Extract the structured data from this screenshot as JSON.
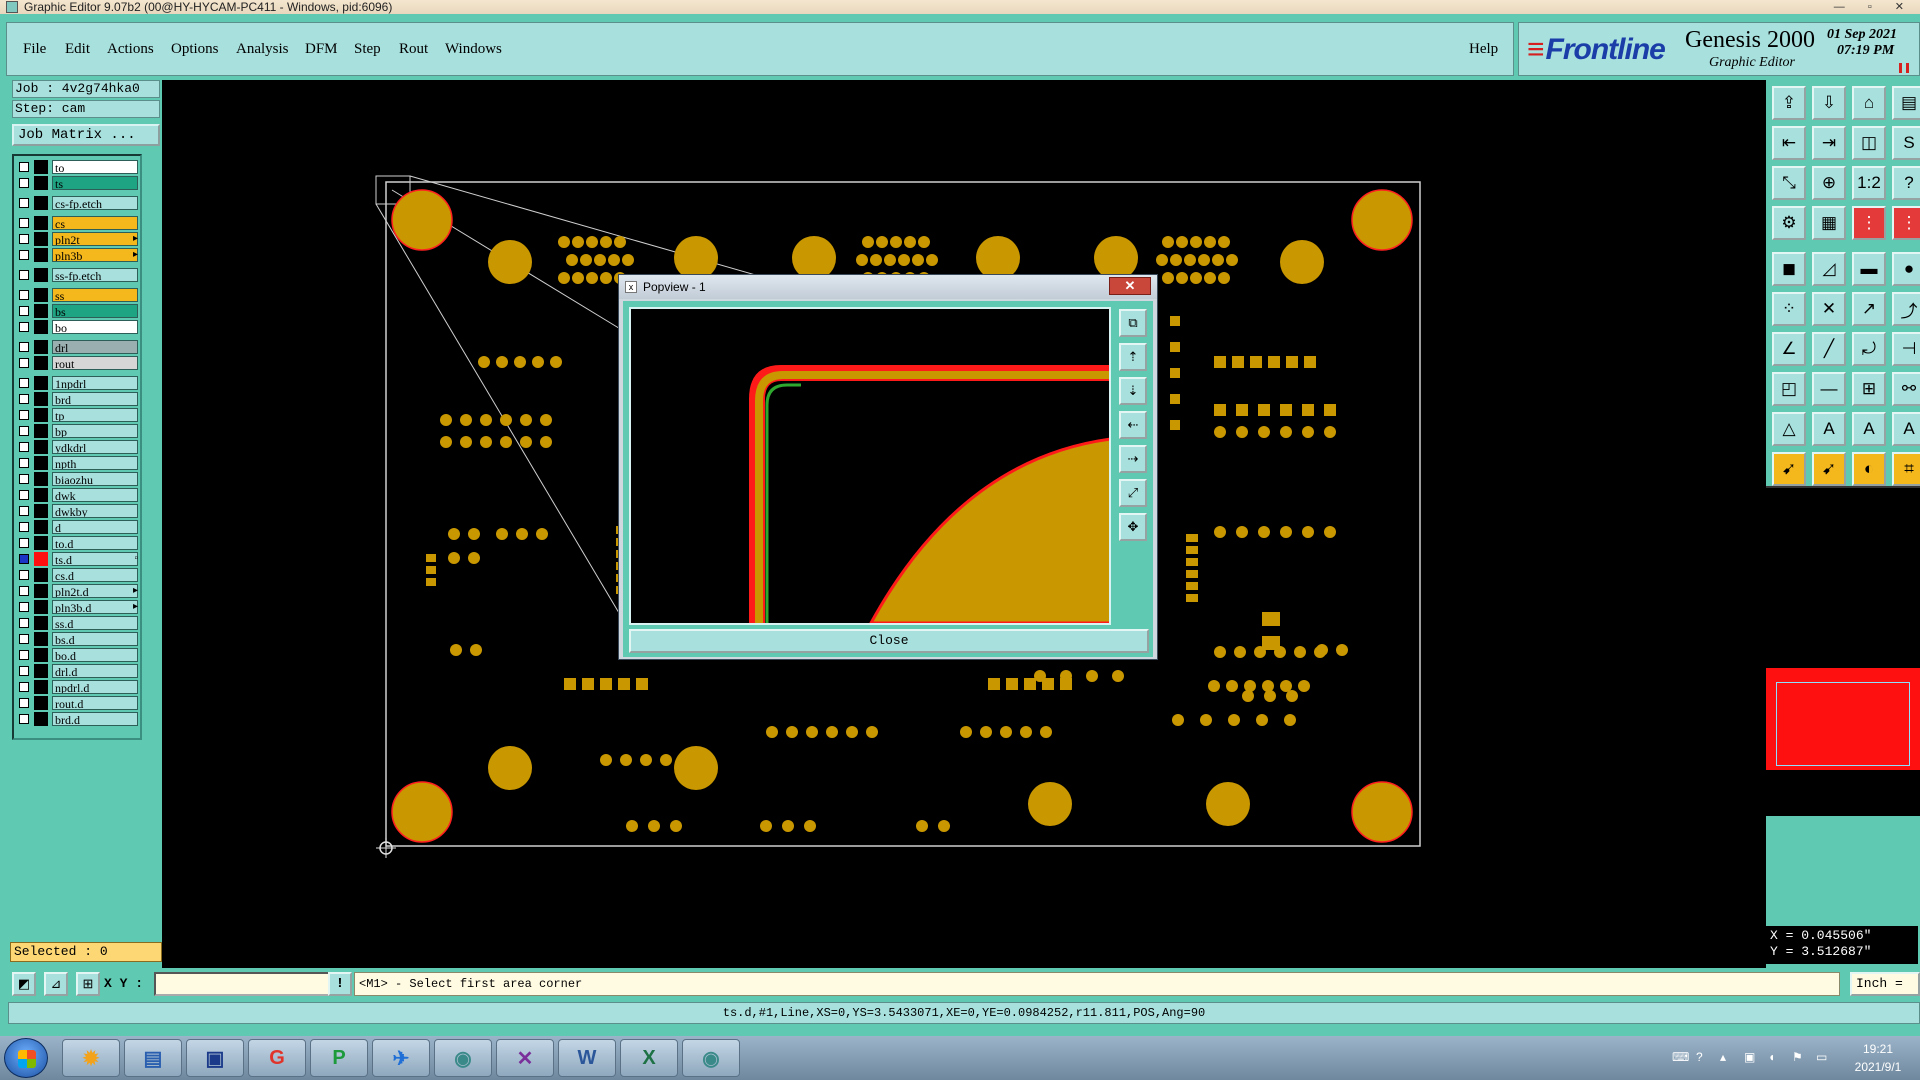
{
  "window": {
    "title": "Graphic Editor 9.07b2 (00@HY-HYCAM-PC411 - Windows, pid:6096)",
    "controls": "— ▫ ✕"
  },
  "menubar": {
    "items": [
      "File",
      "Edit",
      "Actions",
      "Options",
      "Analysis",
      "DFM",
      "Step",
      "Rout",
      "Windows"
    ],
    "help": "Help"
  },
  "brand": {
    "logo": "Frontline",
    "product": "Genesis 2000",
    "module": "Graphic Editor",
    "date": "01 Sep 2021",
    "time": "07:19 PM"
  },
  "job": {
    "job_label": "Job : 4v2g74hka0",
    "step_label": "Step: cam",
    "matrix_button": "Job Matrix ..."
  },
  "layers": [
    {
      "name": "to",
      "color": "#ffffff",
      "active": false,
      "arrow": ""
    },
    {
      "name": "ts",
      "color": "#1ea383",
      "active": false,
      "arrow": ""
    },
    {
      "name": "cs-fp.etch",
      "color": "#a7e0dd",
      "active": false,
      "arrow": ""
    },
    {
      "name": "cs",
      "color": "#f4b81c",
      "active": false,
      "arrow": ""
    },
    {
      "name": "pln2t",
      "color": "#f4b81c",
      "active": false,
      "arrow": "▸"
    },
    {
      "name": "pln3b",
      "color": "#f4b81c",
      "active": false,
      "arrow": "▸"
    },
    {
      "name": "ss-fp.etch",
      "color": "#a7e0dd",
      "active": false,
      "arrow": ""
    },
    {
      "name": "ss",
      "color": "#f4b81c",
      "active": false,
      "arrow": ""
    },
    {
      "name": "bs",
      "color": "#1ea383",
      "active": false,
      "arrow": ""
    },
    {
      "name": "bo",
      "color": "#ffffff",
      "active": false,
      "arrow": ""
    },
    {
      "name": "drl",
      "color": "#9ab0b0",
      "active": false,
      "arrow": ""
    },
    {
      "name": "rout",
      "color": "#d6d6d6",
      "active": false,
      "arrow": ""
    },
    {
      "name": "1npdrl",
      "color": "#a7e0dd",
      "active": false,
      "arrow": ""
    },
    {
      "name": "brd",
      "color": "#a7e0dd",
      "active": false,
      "arrow": ""
    },
    {
      "name": "tp",
      "color": "#a7e0dd",
      "active": false,
      "arrow": ""
    },
    {
      "name": "bp",
      "color": "#a7e0dd",
      "active": false,
      "arrow": ""
    },
    {
      "name": "ydkdrl",
      "color": "#a7e0dd",
      "active": false,
      "arrow": ""
    },
    {
      "name": "npth",
      "color": "#a7e0dd",
      "active": false,
      "arrow": ""
    },
    {
      "name": "biaozhu",
      "color": "#a7e0dd",
      "active": false,
      "arrow": ""
    },
    {
      "name": "dwk",
      "color": "#a7e0dd",
      "active": false,
      "arrow": ""
    },
    {
      "name": "dwkby",
      "color": "#a7e0dd",
      "active": false,
      "arrow": ""
    },
    {
      "name": "d",
      "color": "#a7e0dd",
      "active": false,
      "arrow": ""
    },
    {
      "name": "to.d",
      "color": "#a7e0dd",
      "active": false,
      "arrow": ""
    },
    {
      "name": "ts.d",
      "color": "#a7e0dd",
      "active": true,
      "arrow": "▫"
    },
    {
      "name": "cs.d",
      "color": "#a7e0dd",
      "active": false,
      "arrow": ""
    },
    {
      "name": "pln2t.d",
      "color": "#a7e0dd",
      "active": false,
      "arrow": "▸"
    },
    {
      "name": "pln3b.d",
      "color": "#a7e0dd",
      "active": false,
      "arrow": "▸"
    },
    {
      "name": "ss.d",
      "color": "#a7e0dd",
      "active": false,
      "arrow": ""
    },
    {
      "name": "bs.d",
      "color": "#a7e0dd",
      "active": false,
      "arrow": ""
    },
    {
      "name": "bo.d",
      "color": "#a7e0dd",
      "active": false,
      "arrow": ""
    },
    {
      "name": "drl.d",
      "color": "#a7e0dd",
      "active": false,
      "arrow": ""
    },
    {
      "name": "npdrl.d",
      "color": "#a7e0dd",
      "active": false,
      "arrow": ""
    },
    {
      "name": "rout.d",
      "color": "#a7e0dd",
      "active": false,
      "arrow": ""
    },
    {
      "name": "brd.d",
      "color": "#a7e0dd",
      "active": false,
      "arrow": ""
    }
  ],
  "selected": "Selected : 0",
  "popview": {
    "title": "Popview - 1",
    "close_x": "✕",
    "close_button": "Close"
  },
  "coords": {
    "x": "X = 0.045506\"",
    "y": "Y = 3.512687\""
  },
  "command": {
    "xy_label": "X Y :",
    "xy_value": "",
    "bang": "!",
    "prompt": "<M1> - Select first area corner",
    "units": "Inch ="
  },
  "status": "ts.d,#1,Line,XS=0,YS=3.5433071,XE=0,YE=0.0984252,r11.811,POS,Ang=90",
  "taskbar": {
    "apps": [
      "shell-icon",
      "notepad-icon",
      "save-icon",
      "red-app-icon",
      "green-app-icon",
      "bird-icon",
      "fish-icon",
      "x-app-icon",
      "word-icon",
      "excel-icon",
      "fish-icon"
    ],
    "time": "19:21",
    "date": "2021/9/1"
  },
  "colors": {
    "panel": "#5fc9b2",
    "menu": "#a7e0dd",
    "copper": "#c99700",
    "pad_edge": "#ff2020",
    "highlight": "#ff1010"
  }
}
